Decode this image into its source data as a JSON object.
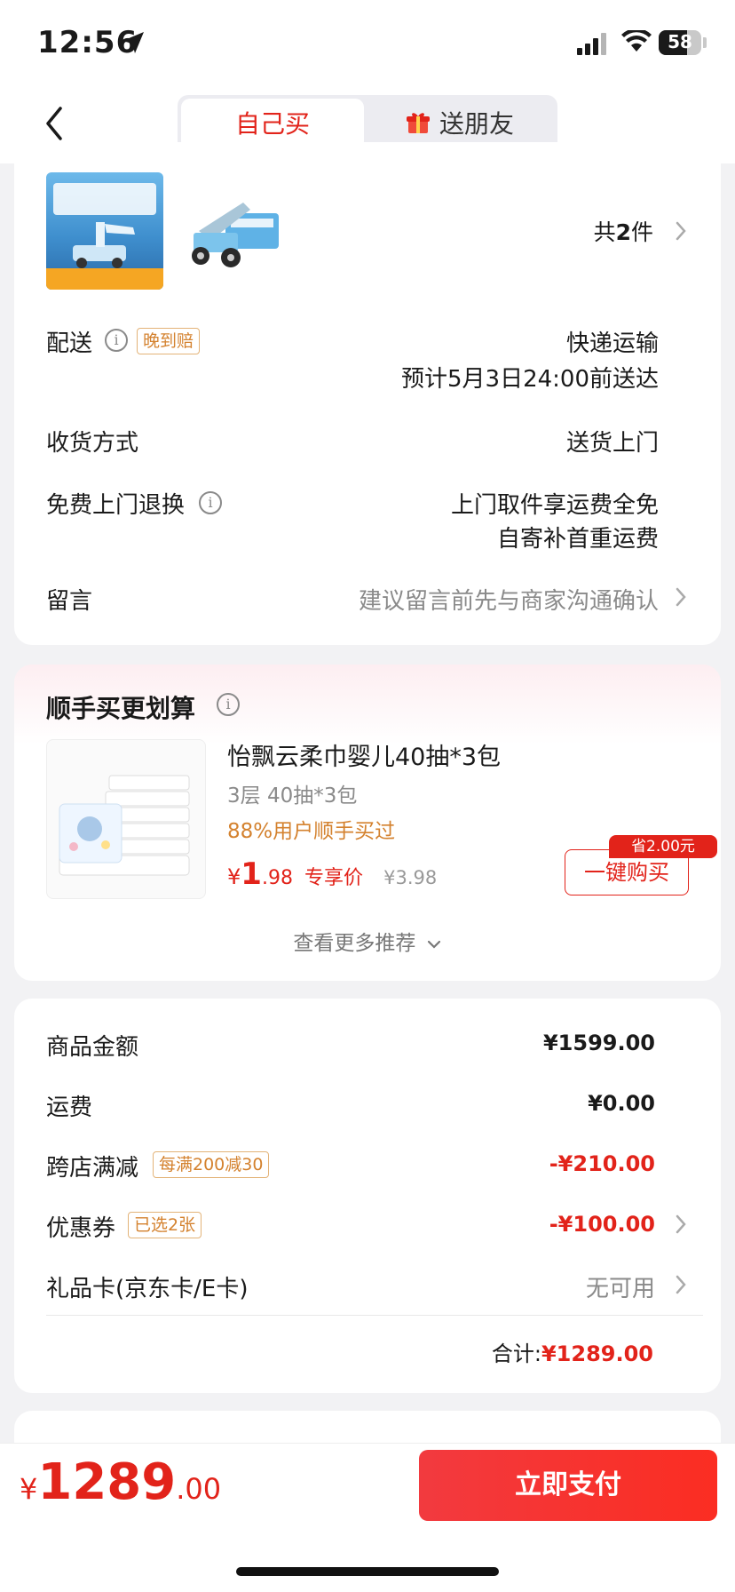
{
  "status_bar": {
    "time": "12:56",
    "battery": "58"
  },
  "nav": {
    "tab_self": "自己买",
    "tab_gift": "送朋友"
  },
  "order": {
    "count_prefix": "共",
    "count": "2",
    "count_suffix": "件",
    "delivery_label": "配送",
    "delivery_tag": "晚到赔",
    "delivery_method": "快递运输",
    "delivery_eta": "预计5月3日24:00前送达",
    "receive_label": "收货方式",
    "receive_value": "送货上门",
    "return_label": "免费上门退换",
    "return_line1": "上门取件享运费全免",
    "return_line2": "自寄补首重运费",
    "note_label": "留言",
    "note_placeholder": "建议留言前先与商家沟通确认"
  },
  "upsell": {
    "title": "顺手买更划算",
    "product_name": "怡飘云柔巾婴儿40抽*3包",
    "spec": "3层 40抽*3包",
    "buyers": "88%用户顺手买过",
    "price_symbol": "¥",
    "price_int": "1",
    "price_dec": ".98",
    "price_tag": "专享价",
    "orig_price": "¥3.98",
    "save_badge": "省2.00元",
    "buy_button": "一键购买",
    "more": "查看更多推荐"
  },
  "summary": {
    "goods_label": "商品金额",
    "goods_value": "¥1599.00",
    "shipping_label": "运费",
    "shipping_value": "¥0.00",
    "promo_label": "跨店满减",
    "promo_tag": "每满200减30",
    "promo_value": "-¥210.00",
    "coupon_label": "优惠券",
    "coupon_tag": "已选2张",
    "coupon_value": "-¥100.00",
    "giftcard_label": "礼品卡(京东卡/E卡)",
    "giftcard_value": "无可用",
    "total_label": "合计:",
    "total_value": "¥1289.00"
  },
  "bottom": {
    "price_symbol": "¥",
    "price_int": "1289",
    "price_dec": ".00",
    "pay_button": "立即支付"
  },
  "colors": {
    "accent": "#e2231a",
    "tag_orange": "#d4822f",
    "background": "#f2f2f4"
  }
}
